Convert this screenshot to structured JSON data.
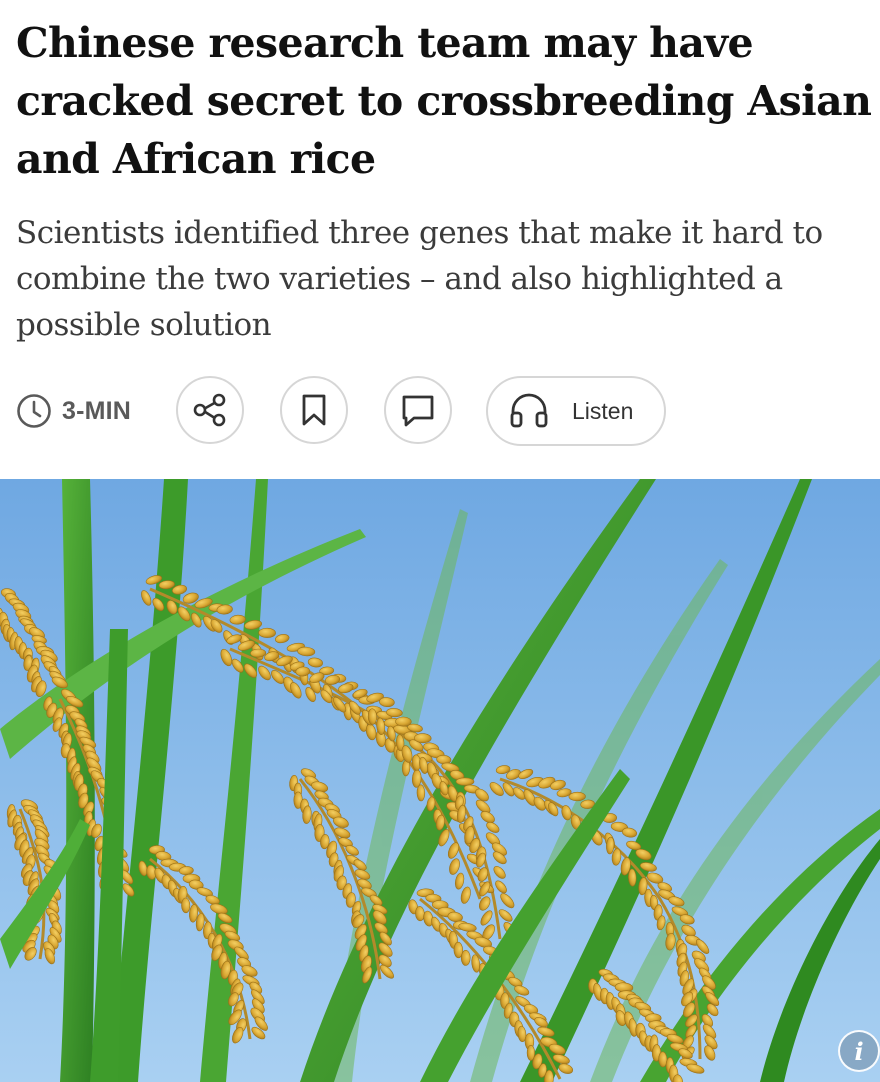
{
  "article": {
    "headline": "Chinese research team may have cracked secret to crossbreeding Asian and African rice",
    "subheadline": "Scientists identified three genes that make it hard to combine the two varieties – and also highlighted a possible solution"
  },
  "toolbar": {
    "read_time": "3-MIN",
    "listen_label": "Listen",
    "icons": [
      "clock-icon",
      "share-icon",
      "bookmark-icon",
      "comment-icon",
      "headphones-icon"
    ]
  },
  "hero_image": {
    "subject": "rice panicles against blue sky",
    "info_glyph": "i"
  },
  "colors": {
    "headline": "#111111",
    "subheadline": "#3b3b3b",
    "button_border": "#d6d6d6",
    "sky": "#7fb4e6",
    "grain": "#d9a733",
    "leaf": "#3f9a2c"
  }
}
